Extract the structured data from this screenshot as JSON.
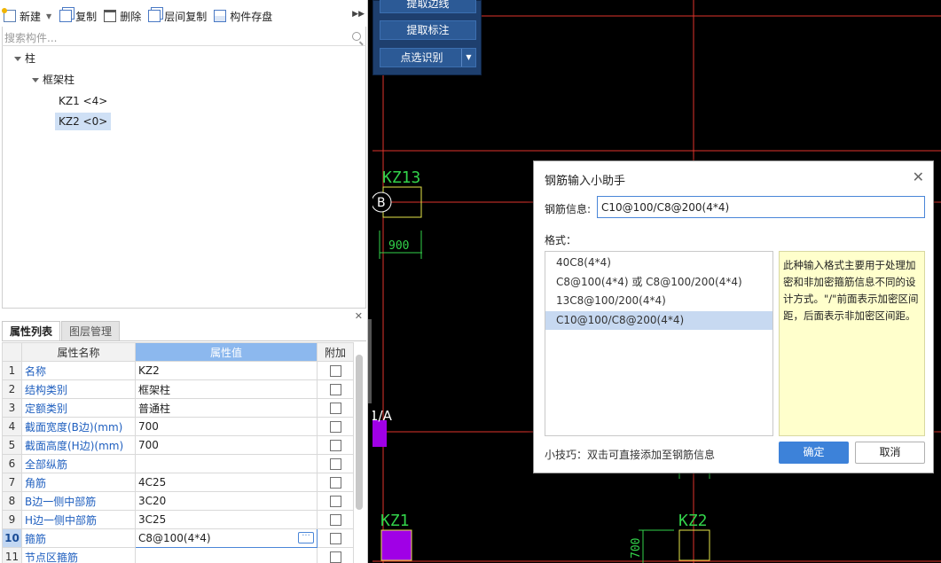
{
  "toolbar": {
    "new_label": "新建",
    "copy_label": "复制",
    "delete_label": "删除",
    "floor_copy_label": "层间复制",
    "save_label": "构件存盘"
  },
  "search": {
    "placeholder": "搜索构件..."
  },
  "tree": {
    "root": "柱",
    "group": "框架柱",
    "items": [
      {
        "label": "KZ1  <4>"
      },
      {
        "label": "KZ2  <0>"
      }
    ]
  },
  "props": {
    "tabs": [
      "属性列表",
      "图层管理"
    ],
    "headers": {
      "name": "属性名称",
      "value": "属性值",
      "attach": "附加"
    },
    "rows": [
      {
        "num": "1",
        "name": "名称",
        "value": "KZ2"
      },
      {
        "num": "2",
        "name": "结构类别",
        "value": "框架柱"
      },
      {
        "num": "3",
        "name": "定额类别",
        "value": "普通柱"
      },
      {
        "num": "4",
        "name": "截面宽度(B边)(mm)",
        "value": "700"
      },
      {
        "num": "5",
        "name": "截面高度(H边)(mm)",
        "value": "700"
      },
      {
        "num": "6",
        "name": "全部纵筋",
        "value": ""
      },
      {
        "num": "7",
        "name": "角筋",
        "value": "4C25"
      },
      {
        "num": "8",
        "name": "B边一侧中部筋",
        "value": "3C20"
      },
      {
        "num": "9",
        "name": "H边一侧中部筋",
        "value": "3C25"
      },
      {
        "num": "10",
        "name": "箍筋",
        "value": "C8@100(4*4)"
      },
      {
        "num": "11",
        "name": "节点区箍筋",
        "value": ""
      }
    ]
  },
  "ops": {
    "btn1": "提取边线",
    "btn2": "提取标注",
    "btn3": "点选识别"
  },
  "cad": {
    "labels": {
      "kz13": "KZ13",
      "axis_b": "B",
      "dim_900": "900",
      "axis_1a": "1/A",
      "kz1": "KZ1",
      "kz2": "KZ2",
      "dim_700": "700"
    }
  },
  "dialog": {
    "title": "钢筋输入小助手",
    "rebar_label": "钢筋信息:",
    "rebar_value": "C10@100/C8@200(4*4)",
    "format_label": "格式：",
    "formats": [
      "40C8(4*4)",
      "C8@100(4*4) 或 C8@100/200(4*4)",
      "13C8@100/200(4*4)",
      "C10@100/C8@200(4*4)"
    ],
    "description": "此种输入格式主要用于处理加密和非加密箍筋信息不同的设计方式。\"/\"前面表示加密区间距，后面表示非加密区间距。",
    "tip": "小技巧：双击可直接添加至钢筋信息",
    "ok": "确定",
    "cancel": "取消"
  },
  "colors": {
    "accent": "#3d82d9",
    "cad_red": "#e0342c",
    "cad_green": "#32d24a",
    "cad_yellow": "#e6e64a",
    "cad_purple": "#a000e6"
  }
}
